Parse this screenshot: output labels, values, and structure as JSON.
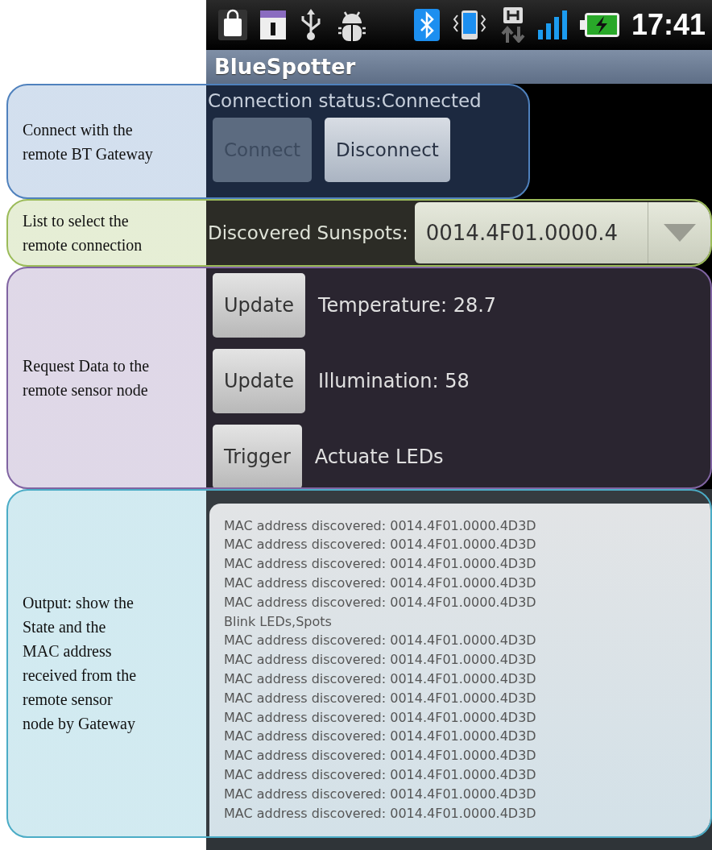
{
  "status_bar": {
    "time": "17:41"
  },
  "app_bar": {
    "title": "BlueSpotter"
  },
  "annotations": [
    {
      "text": "Connect with the\nremote BT Gateway",
      "color": "#4f81bd"
    },
    {
      "text": "List to select the\nremote connection",
      "color": "#9bbb59"
    },
    {
      "text": "Request Data to the\nremote sensor node",
      "color": "#8064a2"
    },
    {
      "text": "Output: show the\nState and the\nMAC address\nreceived from the\nremote sensor\nnode by Gateway",
      "color": "#4bacc6"
    }
  ],
  "connection": {
    "status": "Connection status:Connected",
    "buttons": [
      {
        "label": "Connect",
        "disabled": true
      },
      {
        "label": "Disconnect",
        "disabled": false
      }
    ]
  },
  "discovered": {
    "label": "Discovered Sunspots:",
    "value": "0014.4F01.0000.4"
  },
  "sensors": [
    {
      "button": "Update",
      "text": "Temperature: 28.7"
    },
    {
      "button": "Update",
      "text": "Illumination: 58"
    },
    {
      "button": "Trigger",
      "text": "Actuate LEDs"
    }
  ],
  "output": {
    "lines": [
      "MAC address discovered: 0014.4F01.0000.4D3D",
      "MAC address discovered: 0014.4F01.0000.4D3D",
      "MAC address discovered: 0014.4F01.0000.4D3D",
      "MAC address discovered: 0014.4F01.0000.4D3D",
      "MAC address discovered: 0014.4F01.0000.4D3D",
      "Blink LEDs,Spots",
      "MAC address discovered: 0014.4F01.0000.4D3D",
      "MAC address discovered: 0014.4F01.0000.4D3D",
      "MAC address discovered: 0014.4F01.0000.4D3D",
      "MAC address discovered: 0014.4F01.0000.4D3D",
      "MAC address discovered: 0014.4F01.0000.4D3D",
      "MAC address discovered: 0014.4F01.0000.4D3D",
      "MAC address discovered: 0014.4F01.0000.4D3D",
      "MAC address discovered: 0014.4F01.0000.4D3D",
      "MAC address discovered: 0014.4F01.0000.4D3D",
      "MAC address discovered: 0014.4F01.0000.4D3D"
    ]
  }
}
